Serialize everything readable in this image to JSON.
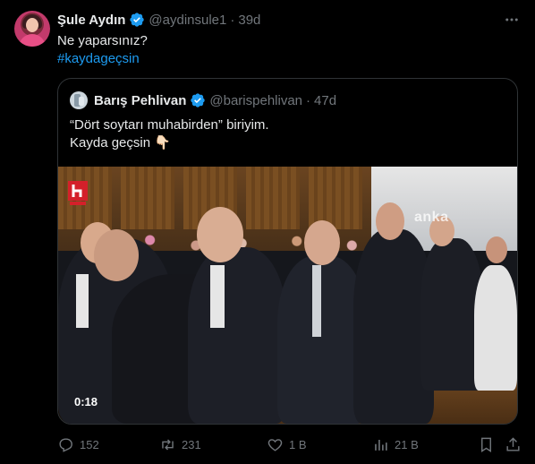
{
  "tweet": {
    "author_name": "Şule Aydın",
    "handle": "@aydinsule1",
    "separator": "·",
    "time": "39d",
    "line1": "Ne yaparsınız?",
    "hashtag": "#kaydageçsin"
  },
  "quoted": {
    "author_name": "Barış Pehlivan",
    "handle": "@barispehlivan",
    "separator": "·",
    "time": "47d",
    "line1": "“Dört soytarı muhabirden” biriyim.",
    "line2": "Kayda geçsin 👇🏻",
    "video": {
      "duration": "0:18",
      "watermark": "anka",
      "channel_logo": "halk"
    }
  },
  "actions": {
    "replies": "152",
    "reposts": "231",
    "likes": "1 B",
    "views": "21 B"
  },
  "colors": {
    "background": "#000000",
    "text": "#e7e9ea",
    "muted": "#71767b",
    "accent": "#1d9bf0",
    "border": "#2f3336"
  },
  "icons": [
    "more-icon",
    "verified-icon",
    "reply-icon",
    "repost-icon",
    "like-icon",
    "views-icon",
    "bookmark-icon",
    "share-icon"
  ]
}
